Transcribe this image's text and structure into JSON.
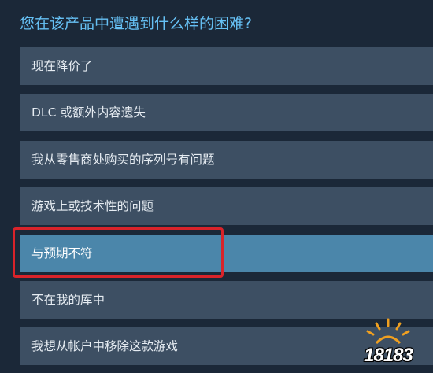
{
  "title": "您在该产品中遭遇到什么样的困难?",
  "options": [
    {
      "label": "现在降价了"
    },
    {
      "label": "DLC 或额外内容遗失"
    },
    {
      "label": "我从零售商处购买的序列号有问题"
    },
    {
      "label": "游戏上或技术性的问题"
    },
    {
      "label": "与预期不符",
      "selected": true
    },
    {
      "label": "不在我的库中"
    },
    {
      "label": "我想从帐户中移除这款游戏"
    }
  ],
  "watermark": {
    "text": "18183",
    "icon": "sun-rays-icon"
  },
  "colors": {
    "background": "#1b2838",
    "title": "#66c0f4",
    "option": "#3d4f63",
    "option_selected": "#4b86aa",
    "highlight": "#d9232a"
  }
}
